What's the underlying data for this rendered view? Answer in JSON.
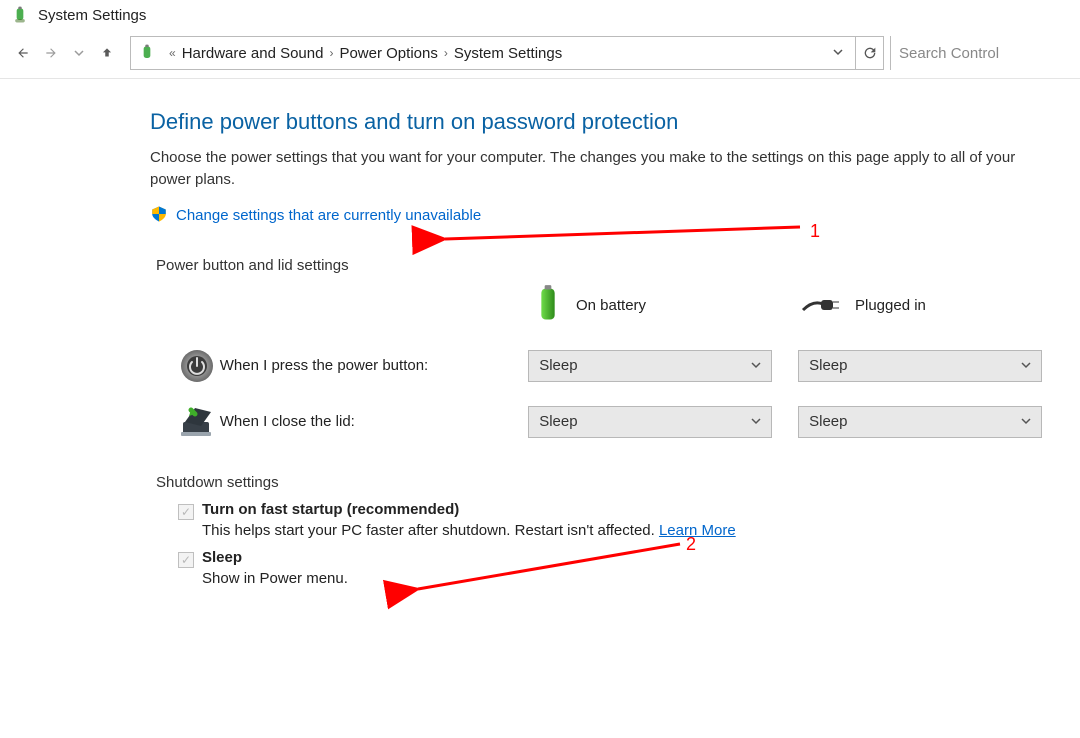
{
  "window": {
    "title": "System Settings"
  },
  "breadcrumb": {
    "parts": [
      "Hardware and Sound",
      "Power Options",
      "System Settings"
    ]
  },
  "search": {
    "placeholder": "Search Control"
  },
  "main": {
    "heading": "Define power buttons and turn on password protection",
    "description": "Choose the power settings that you want for your computer. The changes you make to the settings on this page apply to all of your power plans.",
    "change_link": "Change settings that are currently unavailable"
  },
  "sections": {
    "power_lid": {
      "title": "Power button and lid settings",
      "col_battery": "On battery",
      "col_plugged": "Plugged in",
      "rows": [
        {
          "label": "When I press the power button:",
          "battery": "Sleep",
          "plugged": "Sleep"
        },
        {
          "label": "When I close the lid:",
          "battery": "Sleep",
          "plugged": "Sleep"
        }
      ]
    },
    "shutdown": {
      "title": "Shutdown settings",
      "items": [
        {
          "label": "Turn on fast startup (recommended)",
          "sub": "This helps start your PC faster after shutdown. Restart isn't affected.",
          "learn": "Learn More",
          "checked": true
        },
        {
          "label": "Sleep",
          "sub": "Show in Power menu.",
          "checked": true
        }
      ]
    }
  },
  "annotations": {
    "one": "1",
    "two": "2"
  }
}
